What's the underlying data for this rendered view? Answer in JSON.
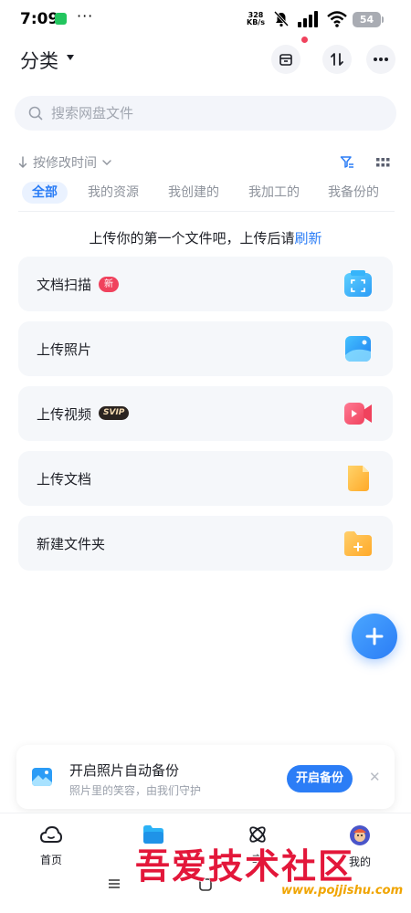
{
  "status_bar": {
    "time": "7:09",
    "net_speed_value": "328",
    "net_speed_unit": "KB/s",
    "battery": "54"
  },
  "header": {
    "title": "分类"
  },
  "search": {
    "placeholder": "搜索网盘文件"
  },
  "sort": {
    "label": "按修改时间"
  },
  "tabs": [
    {
      "label": "全部"
    },
    {
      "label": "我的资源"
    },
    {
      "label": "我创建的"
    },
    {
      "label": "我加工的"
    },
    {
      "label": "我备份的"
    }
  ],
  "hint": {
    "text": "上传你的第一个文件吧，上传后请",
    "link": "刷新"
  },
  "actions": [
    {
      "label": "文档扫描",
      "badge": "新",
      "icon": "scan-icon"
    },
    {
      "label": "上传照片",
      "icon": "photo-icon"
    },
    {
      "label": "上传视频",
      "badge": "SVIP",
      "icon": "video-icon"
    },
    {
      "label": "上传文档",
      "icon": "document-icon"
    },
    {
      "label": "新建文件夹",
      "icon": "new-folder-icon"
    }
  ],
  "backup_banner": {
    "title": "开启照片自动备份",
    "subtitle": "照片里的笑容，由我们守护",
    "button": "开启备份"
  },
  "bottom_nav": [
    {
      "label": "首页",
      "icon": "home-icon"
    },
    {
      "label": "",
      "icon": "files-icon"
    },
    {
      "label": "享",
      "icon": "share-icon"
    },
    {
      "label": "我的",
      "icon": "avatar-icon"
    }
  ],
  "watermark": {
    "text": "吾爱技术社区",
    "url": "www.pojjishu.com"
  },
  "colors": {
    "accent": "#2b7df6",
    "badge_red": "#f0425d",
    "card_bg": "#f5f7fa"
  }
}
